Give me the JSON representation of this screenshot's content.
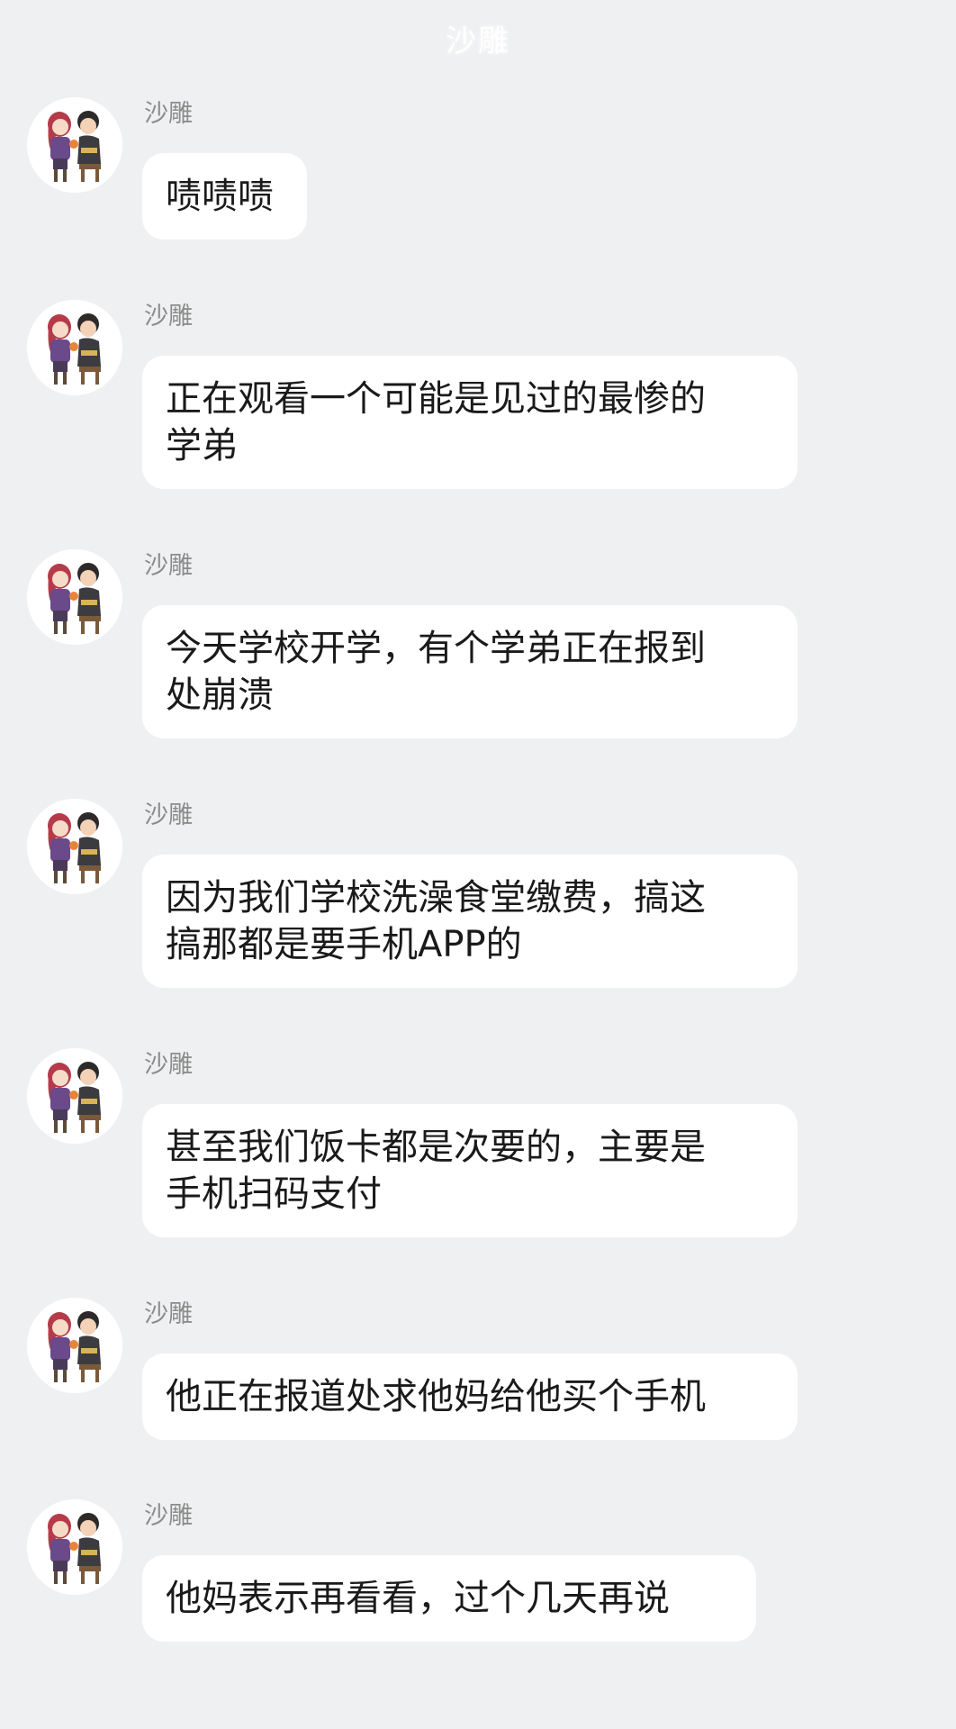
{
  "header": {
    "title": "沙雕"
  },
  "messages": [
    {
      "sender": "沙雕",
      "avatar_icon": "anime-couple-avatar-icon",
      "lines": [
        "啧啧啧"
      ]
    },
    {
      "sender": "沙雕",
      "avatar_icon": "anime-couple-avatar-icon",
      "lines": [
        "正在观看一个可能是见过的最惨的",
        "学弟"
      ]
    },
    {
      "sender": "沙雕",
      "avatar_icon": "anime-couple-avatar-icon",
      "lines": [
        "今天学校开学，有个学弟正在报到",
        "处崩溃"
      ]
    },
    {
      "sender": "沙雕",
      "avatar_icon": "anime-couple-avatar-icon",
      "lines": [
        "因为我们学校洗澡食堂缴费，搞这",
        "搞那都是要手机APP的"
      ]
    },
    {
      "sender": "沙雕",
      "avatar_icon": "anime-couple-avatar-icon",
      "lines": [
        "甚至我们饭卡都是次要的，主要是",
        "手机扫码支付"
      ]
    },
    {
      "sender": "沙雕",
      "avatar_icon": "anime-couple-avatar-icon",
      "lines": [
        "他正在报道处求他妈给他买个手机"
      ]
    },
    {
      "sender": "沙雕",
      "avatar_icon": "anime-couple-avatar-icon",
      "lines": [
        "他妈表示再看看，过个几天再说"
      ]
    }
  ],
  "colors": {
    "background": "#eff0f1",
    "bubble": "#ffffff",
    "text": "#1a1a1a",
    "sender": "#8c8c8c"
  }
}
